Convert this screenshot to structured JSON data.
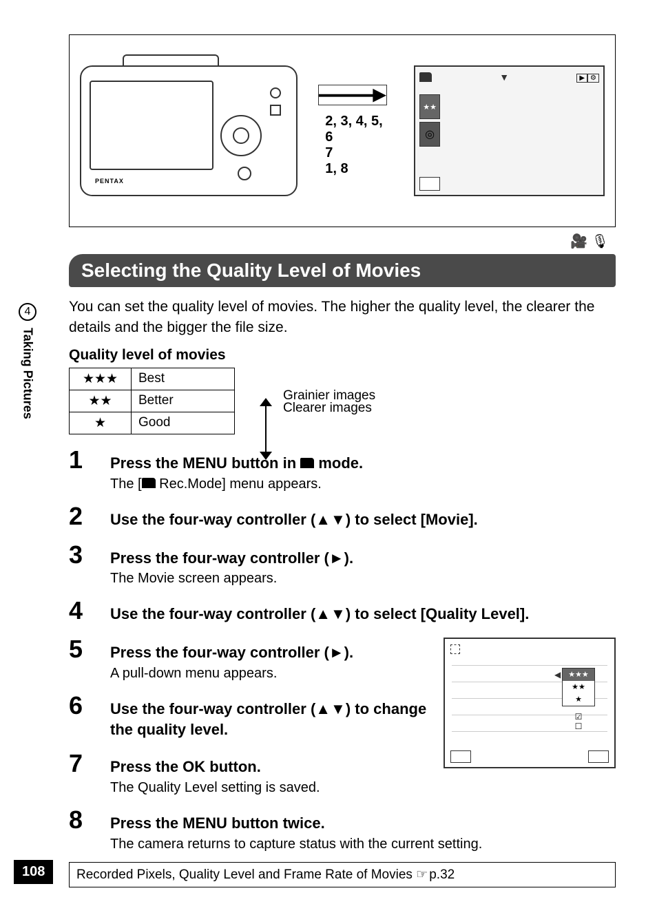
{
  "page_number": "108",
  "side_tab": {
    "chapter_num": "4",
    "label": "Taking Pictures"
  },
  "diagram": {
    "callouts": [
      "2, 3, 4, 5, 6",
      "7",
      "1, 8"
    ],
    "camera_brand": "PENTAX",
    "mode_icons_alt": "movie-mode voice-mode"
  },
  "section_title": "Selecting the Quality Level of Movies",
  "intro_text": "You can set the quality level of movies. The higher the quality level, the clearer the details and the bigger the file size.",
  "quality_heading": "Quality level of movies",
  "quality_table": {
    "rows": [
      {
        "symbol": "★★★",
        "name": "Best"
      },
      {
        "symbol": "★★",
        "name": "Better"
      },
      {
        "symbol": "★",
        "name": "Good"
      }
    ],
    "range_top": "Clearer images",
    "range_bottom": "Grainier images"
  },
  "steps": [
    {
      "num": "1",
      "title_pre": "Press the ",
      "title_ui": "MENU",
      "title_mid": " button in ",
      "title_icon": "camera",
      "title_post": " mode.",
      "desc_pre": "The [",
      "desc_icon": "camera",
      "desc_post": " Rec.Mode] menu appears."
    },
    {
      "num": "2",
      "title_pre": "Use the four-way controller (",
      "title_arrows": "▲▼",
      "title_post": ") to select [Movie]."
    },
    {
      "num": "3",
      "title_pre": "Press the four-way controller (",
      "title_arrows": "►",
      "title_post": ").",
      "desc": "The Movie screen appears."
    },
    {
      "num": "4",
      "title_pre": "Use the four-way controller (",
      "title_arrows": "▲▼",
      "title_post": ") to select [Quality Level]."
    },
    {
      "num": "5",
      "title_pre": "Press the four-way controller (",
      "title_arrows": "►",
      "title_post": ").",
      "desc": "A pull-down menu appears."
    },
    {
      "num": "6",
      "title_pre": "Use the four-way controller (",
      "title_arrows": "▲▼",
      "title_post": ") to change the quality level."
    },
    {
      "num": "7",
      "title_pre": "Press the ",
      "title_ui": "OK",
      "title_post": " button.",
      "desc": "The Quality Level setting is saved."
    },
    {
      "num": "8",
      "title_pre": "Press the ",
      "title_ui": "MENU",
      "title_post": " button twice.",
      "desc": "The camera returns to capture status with the current setting."
    }
  ],
  "dropdown": {
    "options": [
      "★★★",
      "★★",
      "★"
    ],
    "extra": [
      "☑",
      "☐"
    ]
  },
  "reference": {
    "text": "Recorded Pixels, Quality Level and Frame Rate of Movies ",
    "page_ref": "p.32"
  }
}
